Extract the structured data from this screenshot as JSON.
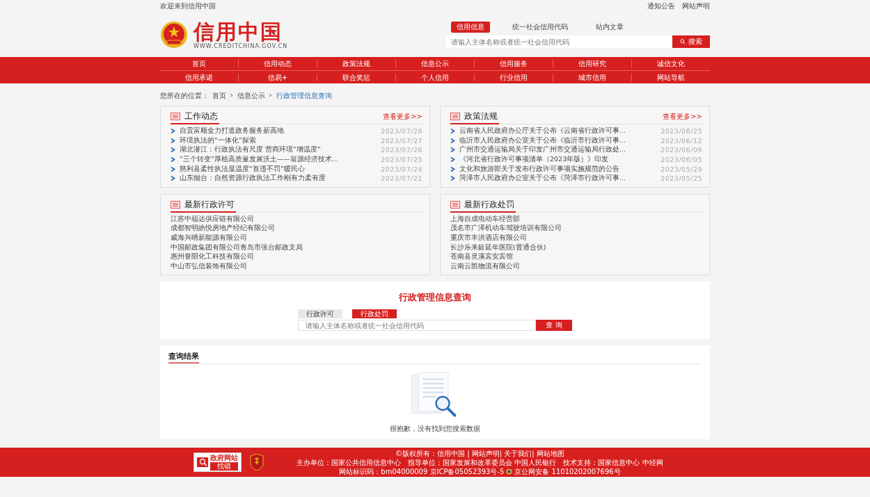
{
  "top_bar": {
    "welcome": "欢迎来到信用中国",
    "links": [
      "通知公告",
      "网站声明"
    ]
  },
  "header": {
    "logo_title": "信用中国",
    "logo_url": "WWW.CREDITCHINA.GOV.CN",
    "search_tabs": [
      {
        "label": "信用信息",
        "selected": true
      },
      {
        "label": "统一社会信用代码",
        "selected": false
      },
      {
        "label": "站内文章",
        "selected": false
      }
    ],
    "search_placeholder": "请输入主体名称或者统一社会信用代码",
    "search_button": "搜索"
  },
  "nav": [
    [
      "首页",
      "信用动态",
      "政策法规",
      "信息公示",
      "信用服务",
      "信用研究",
      "诚信文化"
    ],
    [
      "信用承诺",
      "信易+",
      "联合奖惩",
      "个人信用",
      "行业信用",
      "城市信用",
      "网站导航"
    ]
  ],
  "breadcrumb": {
    "label": "您所在的位置：",
    "items": [
      "首页",
      "信息公示",
      "行政管理信息查询"
    ]
  },
  "panels": [
    {
      "kind": "news",
      "title": "工作动态",
      "more": "查看更多>>",
      "items": [
        {
          "text": "自贡富顺全力打造政务服务新高地",
          "date": "2023/07/28"
        },
        {
          "text": "环境执法的“一体化”探索",
          "date": "2023/07/27"
        },
        {
          "text": "湖北潜江：行政执法有尺度 营商环境“增温度”",
          "date": "2023/07/26"
        },
        {
          "text": "“三个转变”厚植高质量发展沃土——翁源经济技术...",
          "date": "2023/07/25"
        },
        {
          "text": "慈利县柔性执法显温度“首违不罚”暖民心",
          "date": "2023/07/24"
        },
        {
          "text": "山东烟台：自然资源行政执法工作刚有力柔有度",
          "date": "2023/07/21"
        }
      ]
    },
    {
      "kind": "news",
      "title": "政策法规",
      "more": "查看更多>>",
      "items": [
        {
          "text": "云南省人民政府办公厅关于公布《云南省行政许可事...",
          "date": "2023/06/25"
        },
        {
          "text": "临沂市人民政府办公室关于公布《临沂市行政许可事...",
          "date": "2023/06/12"
        },
        {
          "text": "广州市交通运输局关于印发广州市交通运输局行政处...",
          "date": "2023/06/09"
        },
        {
          "text": "《河北省行政许可事项清单（2023年版）》印发",
          "date": "2023/06/05"
        },
        {
          "text": "文化和旅游部关于发布行政许可事项实施规范的公告",
          "date": "2023/05/29"
        },
        {
          "text": "菏泽市人民政府办公室关于公布《菏泽市行政许可事...",
          "date": "2023/05/25"
        }
      ]
    },
    {
      "kind": "list",
      "title": "最新行政许可",
      "items": [
        {
          "text": "江苏中福达供应链有限公司"
        },
        {
          "text": "成都智明皓悦房地产经纪有限公司"
        },
        {
          "text": "威海兴晴新能源有限公司"
        },
        {
          "text": "中国邮政集团有限公司青岛市张台邮政支局"
        },
        {
          "text": "惠州誉阳化工科技有限公司"
        },
        {
          "text": "中山市弘信装饰有限公司"
        }
      ]
    },
    {
      "kind": "list",
      "title": "最新行政处罚",
      "items": [
        {
          "text": "上海自成电动车经营部"
        },
        {
          "text": "茂名市广泽机动车驾驶培训有限公司"
        },
        {
          "text": "重庆市丰洪酒店有限公司"
        },
        {
          "text": "长沙乐来龄延年医院(普通合伙)"
        },
        {
          "text": "苍南县灵溪宾安宾馆"
        },
        {
          "text": "云南云凯物流有限公司"
        }
      ]
    }
  ],
  "query": {
    "title": "行政管理信息查询",
    "tabs": [
      {
        "label": "行政许可",
        "selected": false
      },
      {
        "label": "行政处罚",
        "selected": true
      }
    ],
    "placeholder": "请输入主体名称或者统一社会信用代码",
    "button": "查 询"
  },
  "results": {
    "title": "查询结果",
    "empty_message": "很抱歉，没有找到您搜索数据"
  },
  "footer": {
    "badge": "政府网站",
    "badge_sub": "找错",
    "lines": [
      "©版权所有：信用中国 | 网站声明| 关于我们| 网站地图",
      "主办单位：国家公共信用信息中心　指导单位：国家发展和改革委员会 中国人民银行　技术支持：国家信息中心 中经网"
    ],
    "icp": "网站标识码：bm04000009 京ICP备05052393号-5",
    "police": "京公网安备 11010202007696号"
  }
}
